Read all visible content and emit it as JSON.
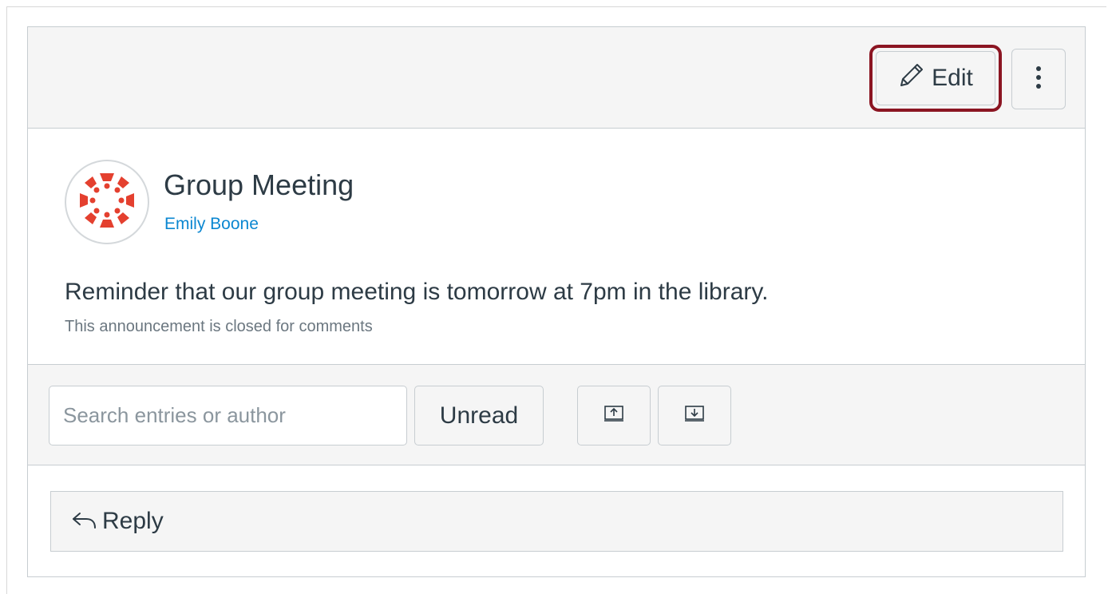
{
  "toolbar": {
    "edit_label": "Edit",
    "highlight_color": "#8b1522"
  },
  "announcement": {
    "title": "Group Meeting",
    "author": "Emily Boone",
    "message": "Reminder that our group meeting is tomorrow at 7pm in the library.",
    "comments_note": "This announcement is closed for comments",
    "avatar_icon": "canvas-logo-icon",
    "avatar_color": "#e4402f"
  },
  "filters": {
    "search_placeholder": "Search entries or author",
    "unread_label": "Unread",
    "collapse_icon": "collapse-threads-icon",
    "expand_icon": "expand-threads-icon"
  },
  "reply": {
    "label": "Reply",
    "icon": "reply-arrow-icon"
  },
  "colors": {
    "link": "#0b87d1",
    "text": "#2d3b45",
    "muted": "#6b7780",
    "border": "#c7cdd1",
    "panel": "#f5f5f5"
  }
}
